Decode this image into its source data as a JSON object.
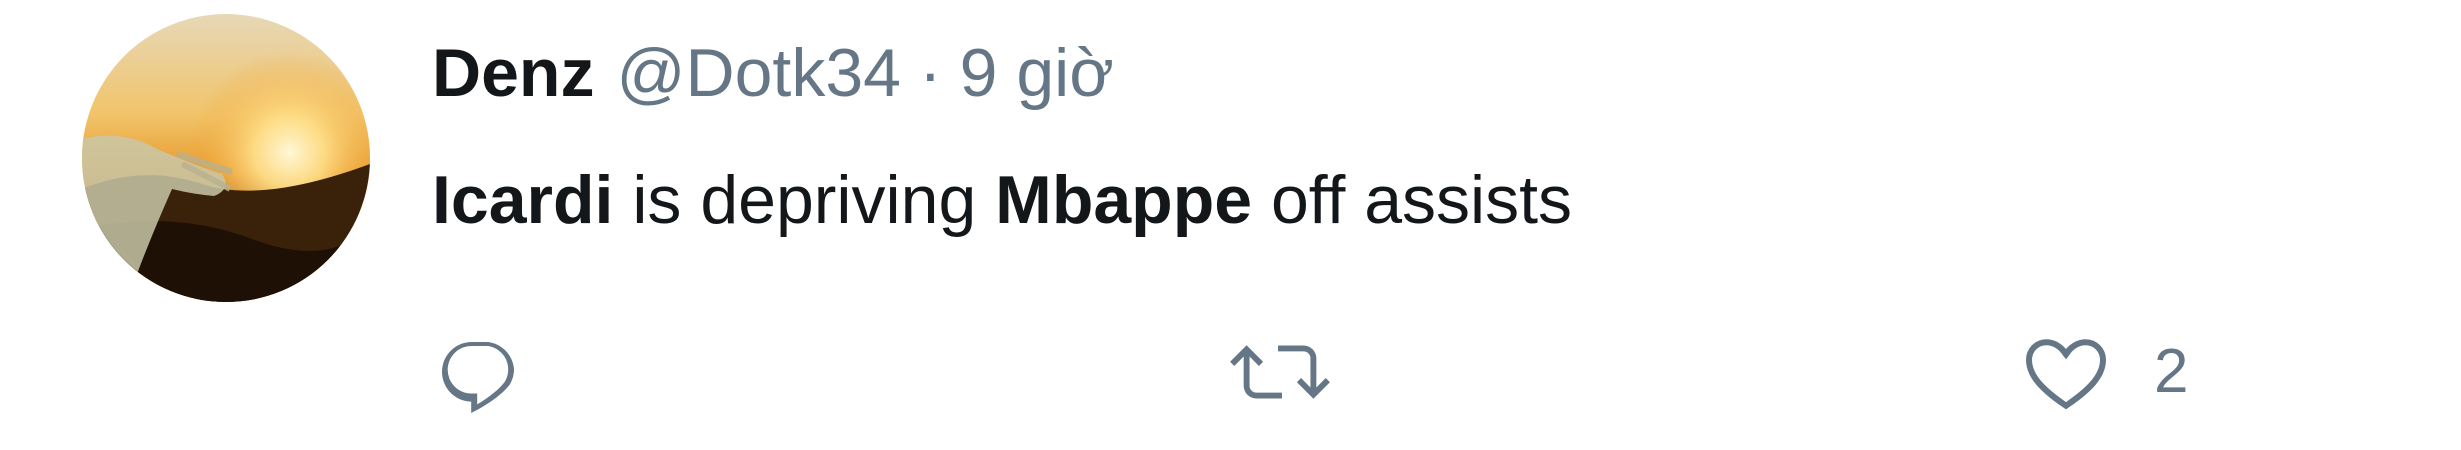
{
  "tweet": {
    "author": {
      "display_name": "Denz",
      "handle": "@Dotk34",
      "avatar_icon": "sunset-hand-avatar"
    },
    "separator": "·",
    "timestamp": "9 giờ",
    "text": {
      "part1": "Icardi",
      "part2": " is depriving ",
      "part3": "Mbappe",
      "part4": " off assists"
    },
    "actions": {
      "reply_icon": "reply-icon",
      "retweet_icon": "retweet-icon",
      "like_icon": "heart-icon",
      "like_count": "2"
    }
  },
  "colors": {
    "primary_text": "#14171a",
    "secondary_text": "#657786",
    "background": "#ffffff"
  }
}
